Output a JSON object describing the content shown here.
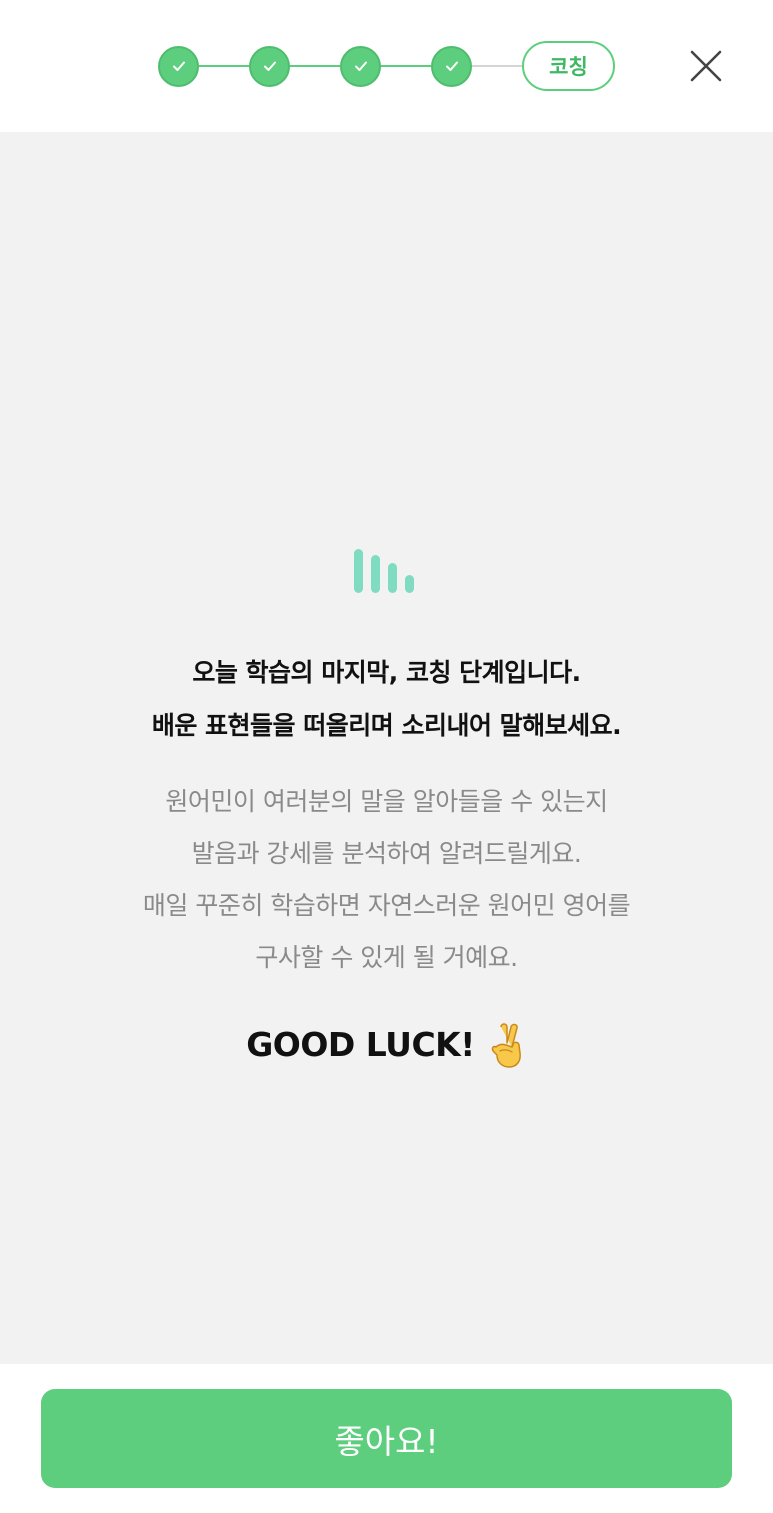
{
  "progress": {
    "completed_steps": 4,
    "total_steps": 5,
    "current_step_label": "코칭"
  },
  "header": {
    "close_icon": "close-icon"
  },
  "main": {
    "illustration_icon": "sound-wave-icon",
    "headline_lines": [
      "오늘 학습의 마지막, 코칭 단계입니다.",
      "배운 표현들을 떠올리며 소리내어 말해보세요."
    ],
    "body_lines": [
      "원어민이 여러분의 말을 알아들을 수 있는지",
      "발음과 강세를 분석하여 알려드릴게요.",
      "매일 꾸준히 학습하면 자연스러운 원어민 영어를",
      "구사할 수 있게 될 거예요."
    ],
    "luck_text": "GOOD LUCK!",
    "luck_icon": "crossed-fingers-icon"
  },
  "footer": {
    "confirm_label": "좋아요!"
  },
  "colors": {
    "accent": "#5dce7d",
    "accent_text": "#3fb864",
    "wave": "#7fdcc0",
    "background": "#f2f2f2",
    "headline": "#111111",
    "body": "#8a8a8a"
  }
}
